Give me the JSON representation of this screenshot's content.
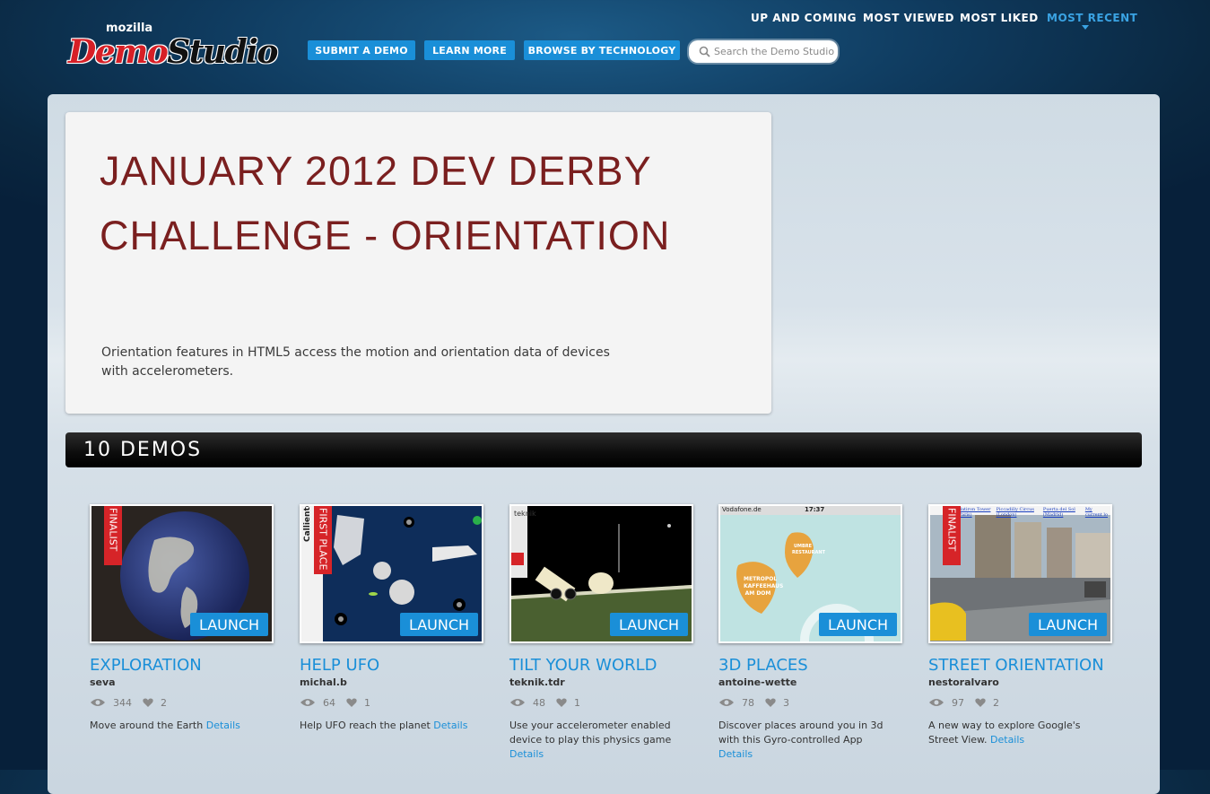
{
  "header": {
    "logo_small": "mozilla",
    "logo_demo": "Demo",
    "logo_studio": "Studio",
    "nav": [
      "SUBMIT A DEMO",
      "LEARN MORE",
      "BROWSE BY TECHNOLOGY"
    ],
    "search_placeholder": "Search the Demo Studio"
  },
  "hero": {
    "title": "JANUARY 2012 DEV DERBY CHALLENGE - ORIENTATION",
    "description": "Orientation features in HTML5 access the motion and orientation data of devices with accelerometers."
  },
  "demos_bar": {
    "count": "10 DEMOS",
    "sort_options": [
      "UP AND COMING",
      "MOST VIEWED",
      "MOST LIKED",
      "MOST RECENT"
    ],
    "active_sort": "MOST RECENT"
  },
  "launch_label": "LAUNCH",
  "details_label": "Details",
  "demos": [
    {
      "title": "EXPLORATION",
      "author": "seva",
      "views": "344",
      "likes": "2",
      "description": "Move around the Earth",
      "badge": "FINALIST"
    },
    {
      "title": "HELP UFO",
      "author": "michal.b",
      "views": "64",
      "likes": "1",
      "description": "Help UFO reach the planet",
      "badge": "FIRST PLACE"
    },
    {
      "title": "TILT YOUR WORLD",
      "author": "teknik.tdr",
      "views": "48",
      "likes": "1",
      "description": "Use your accelerometer enabled device to play this physics game",
      "badge": ""
    },
    {
      "title": "3D PLACES",
      "author": "antoine-wette",
      "views": "78",
      "likes": "3",
      "description": "Discover places around you in 3d with this Gyro-controlled App",
      "badge": ""
    },
    {
      "title": "STREET ORIENTATION",
      "author": "nestoralvaro",
      "views": "97",
      "likes": "2",
      "description": "A new way to explore Google's Street View.",
      "badge": "FINALIST"
    }
  ],
  "thumbnail_text": {
    "ufo_side": "Calliente",
    "tilt_side": "teknik",
    "places_carrier": "Vodafone.de",
    "places_time": "17:37",
    "places_pin1": "UMBRE RESTAURANT",
    "places_pin2": "METROPOL KAFFEEHAUS AM DOM",
    "street_links": [
      "Flatiron Tower (Paris)",
      "Piccadilly Circus (London)",
      "Puerta del Sol (Madrid)",
      "My current lo"
    ]
  },
  "colors": {
    "accent": "#1a8fd8",
    "hero_title": "#7a1f1f",
    "ribbon": "#d62428"
  }
}
